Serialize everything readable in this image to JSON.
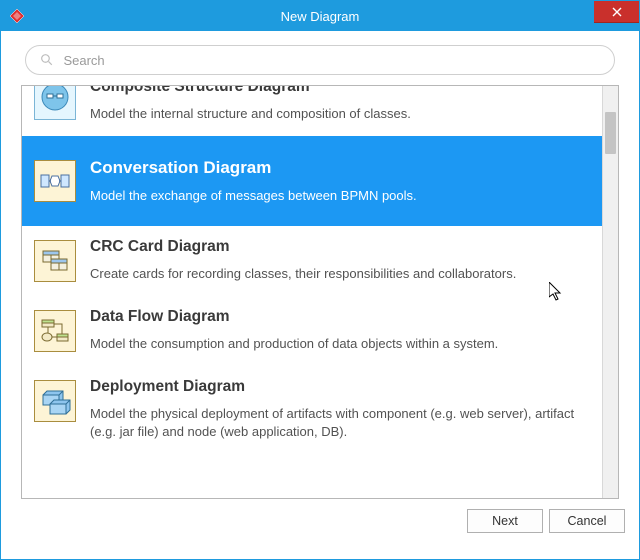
{
  "window": {
    "title": "New Diagram",
    "close_label": "Close"
  },
  "search": {
    "placeholder": "Search",
    "value": ""
  },
  "selected_index": 1,
  "items": [
    {
      "title": "Composite Structure Diagram",
      "desc": "Model the internal structure and composition of classes.",
      "icon": "composite-icon"
    },
    {
      "title": "Conversation Diagram",
      "desc": "Model the exchange of messages between BPMN pools.",
      "icon": "conversation-icon"
    },
    {
      "title": "CRC Card Diagram",
      "desc": "Create cards for recording classes, their responsibilities and collaborators.",
      "icon": "crc-icon"
    },
    {
      "title": "Data Flow Diagram",
      "desc": "Model the consumption and production of data objects within a system.",
      "icon": "dfd-icon"
    },
    {
      "title": "Deployment Diagram",
      "desc": "Model the physical deployment of artifacts with component (e.g. web server), artifact (e.g. jar file) and node (web application, DB).",
      "icon": "deployment-icon"
    }
  ],
  "buttons": {
    "next": "Next",
    "cancel": "Cancel"
  }
}
